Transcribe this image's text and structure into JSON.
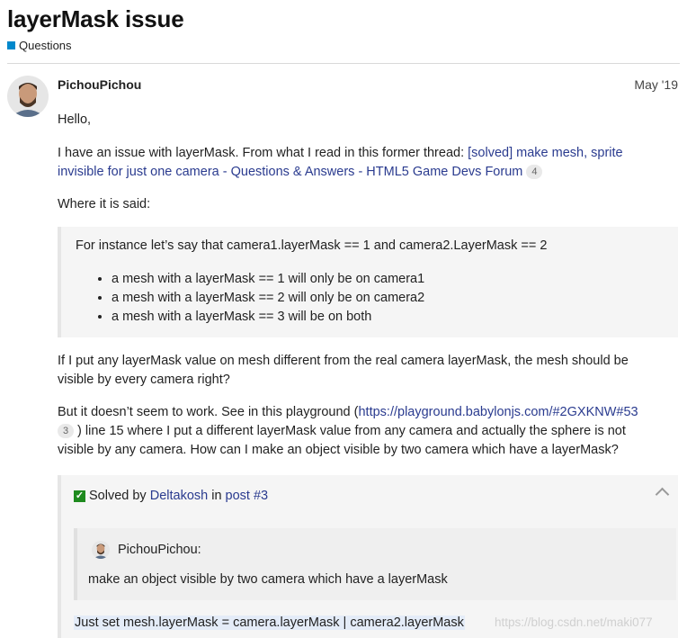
{
  "topic": {
    "title": "layerMask issue",
    "category": "Questions",
    "category_color": "#0088cc"
  },
  "post": {
    "username": "PichouPichou",
    "date": "May '19",
    "greeting": "Hello,",
    "p1_text": "I have an issue with layerMask. From what I read in this former thread: ",
    "p1_link_line1": "[solved] make mesh, sprite",
    "p1_link_line2": "invisible for just one camera - Questions & Answers - HTML5 Game Devs Forum",
    "p1_link_count": "4",
    "where_said": "Where it is said:",
    "quote": {
      "intro": "For instance let’s say that camera1.layerMask == 1 and camera2.LayerMask == 2",
      "items": [
        "a mesh with a layerMask == 1 will only be on camera1",
        "a mesh with a layerMask == 2 will only be on camera2",
        "a mesh with a layerMask == 3 will be on both"
      ]
    },
    "p2_line1": "If I put any layerMask value on mesh different from the real camera layerMask, the mesh should be",
    "p2_line2": "visible by every camera right?",
    "p3_text": "But it doesn’t seem to work. See in this playground (",
    "p3_link": "https://playground.babylonjs.com/#2GXKNW#53",
    "p3_link_count": "3",
    "p3_rest_line1": ") line 15 where I put a different layerMask value from any camera and actually the sphere is not",
    "p3_rest_line2": "visible by any camera. How can I make an object visible by two camera which have a layerMask?"
  },
  "solved": {
    "prefix": "Solved by ",
    "author": "Deltakosh",
    "in": " in ",
    "post_link": "post #3",
    "quote_user": "PichouPichou:",
    "quote_text": "make an object visible by two camera which have a layerMask",
    "answer": "Just set mesh.layerMask = camera.layerMask | camera2.layerMask",
    "check_color": "#1e8a1e"
  },
  "watermark": "https://blog.csdn.net/maki077"
}
